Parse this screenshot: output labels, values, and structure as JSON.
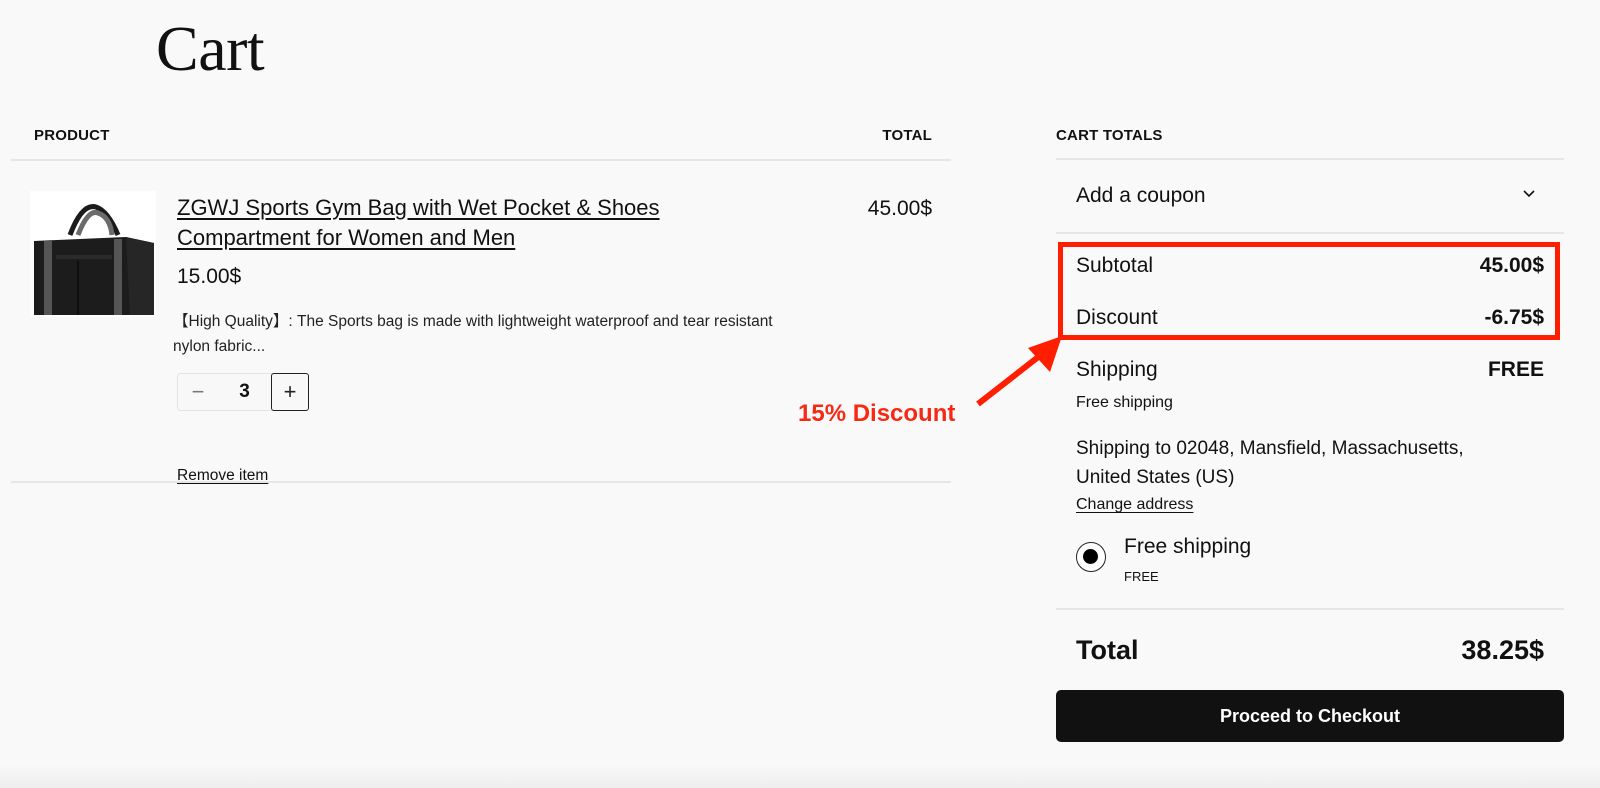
{
  "page": {
    "title": "Cart"
  },
  "cart_table": {
    "headers": {
      "product": "PRODUCT",
      "total": "TOTAL"
    },
    "items": [
      {
        "name": "ZGWJ Sports Gym Bag with Wet Pocket & Shoes Compartment for Women and Men",
        "price": "15.00$",
        "description": "【High Quality】: The Sports bag is made with lightweight waterproof and tear resistant nylon fabric...",
        "quantity": "3",
        "quantity_minus": "−",
        "quantity_plus": "+",
        "remove_label": "Remove item",
        "line_total": "45.00$",
        "image": "black-gym-duffel-bag"
      }
    ]
  },
  "totals": {
    "title": "CART TOTALS",
    "coupon_label": "Add a coupon",
    "coupon_icon": "chevron-down-icon",
    "subtotal_label": "Subtotal",
    "subtotal_value": "45.00$",
    "discount_label": "Discount",
    "discount_value": "-6.75$",
    "shipping_label": "Shipping",
    "shipping_value": "FREE",
    "shipping_method": "Free shipping",
    "shipping_address": "Shipping to 02048, Mansfield, Massachusetts, United States (US)",
    "change_address_label": "Change address",
    "shipping_options": [
      {
        "label": "Free shipping",
        "price": "FREE",
        "selected": true
      }
    ],
    "total_label": "Total",
    "total_value": "38.25$",
    "checkout_label": "Proceed to Checkout"
  },
  "annotation": {
    "text": "15% Discount",
    "color": "#ff1e00"
  }
}
